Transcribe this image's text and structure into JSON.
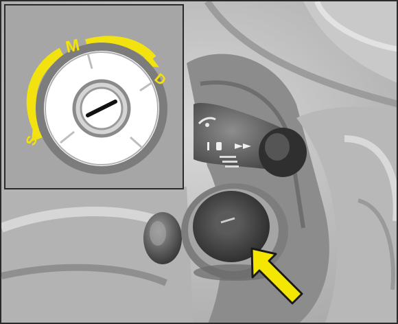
{
  "inset": {
    "positions": {
      "s": "S",
      "m": "M",
      "d": "D"
    }
  },
  "colors": {
    "accent_yellow": "#f2e20f",
    "arrow_yellow": "#f5e600",
    "background_gray": "#bdbdbd",
    "inset_gray": "#a6a6a6",
    "border": "#2a2a2a"
  },
  "icons": {
    "arrow": "yellow-arrow-icon",
    "key": "key-icon",
    "wiper": "wiper-icon",
    "light": "light-icon"
  }
}
